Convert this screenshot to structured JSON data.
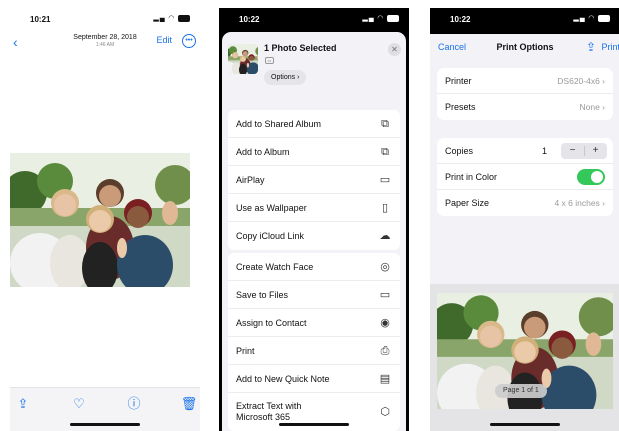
{
  "phone1": {
    "status": {
      "time": "10:21"
    },
    "nav": {
      "date": "September 28, 2018",
      "time_sub": "1:46 AM",
      "edit": "Edit"
    }
  },
  "phone2": {
    "status": {
      "time": "10:22"
    },
    "header": {
      "title": "1 Photo Selected",
      "options_label": "Options ›"
    },
    "group1": [
      {
        "label": "Add to Shared Album",
        "icon": "shared-album-icon"
      },
      {
        "label": "Add to Album",
        "icon": "album-icon"
      },
      {
        "label": "AirPlay",
        "icon": "airplay-icon"
      },
      {
        "label": "Use as Wallpaper",
        "icon": "phone-icon"
      },
      {
        "label": "Copy iCloud Link",
        "icon": "cloud-link-icon"
      }
    ],
    "group2": [
      {
        "label": "Create Watch Face",
        "icon": "watch-icon"
      },
      {
        "label": "Save to Files",
        "icon": "folder-icon"
      },
      {
        "label": "Assign to Contact",
        "icon": "contact-icon"
      },
      {
        "label": "Print",
        "icon": "printer-icon"
      },
      {
        "label": "Add to New Quick Note",
        "icon": "quick-note-icon"
      },
      {
        "label_line1": "Extract Text with",
        "label_line2": "Microsoft 365",
        "icon": "office-icon"
      }
    ]
  },
  "phone3": {
    "status": {
      "time": "10:22"
    },
    "nav": {
      "cancel": "Cancel",
      "title": "Print Options",
      "print": "Print"
    },
    "printer": {
      "label": "Printer",
      "value": "DS620-4x6 ›"
    },
    "presets": {
      "label": "Presets",
      "value": "None ›"
    },
    "copies": {
      "label": "Copies",
      "value": "1",
      "minus": "−",
      "plus": "+"
    },
    "print_in_color": {
      "label": "Print in Color",
      "on": true
    },
    "paper_size": {
      "label": "Paper Size",
      "value": "4 x 6 inches ›"
    },
    "preview": {
      "page_label": "Page 1 of 1"
    }
  },
  "colors": {
    "accent": "#1a73e8",
    "toggle_on": "#34c759",
    "sheet_bg": "#f2f2f7"
  }
}
